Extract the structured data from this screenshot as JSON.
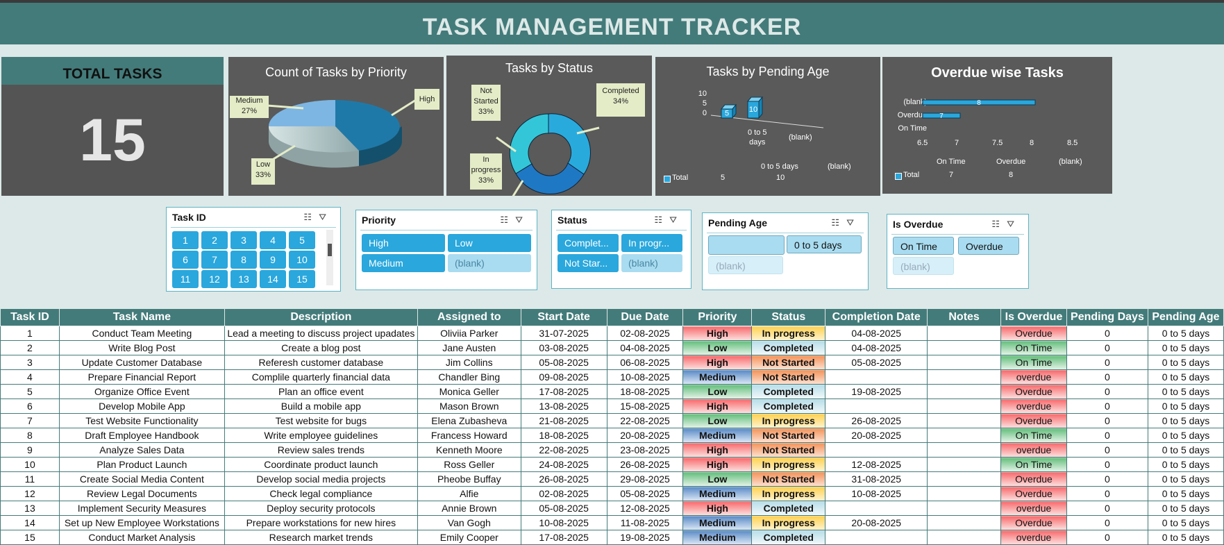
{
  "title": "TASK MANAGEMENT TRACKER",
  "total": {
    "label": "TOTAL TASKS",
    "value": "15"
  },
  "colors": {
    "teal": "#437b7a",
    "panel": "#545454",
    "slicer_selected": "#2aa7dc",
    "high": "#f8696b",
    "low": "#63be7b",
    "medium": "#5a8ac6"
  },
  "chart_data": [
    {
      "type": "pie",
      "title": "Count of Tasks by Priority",
      "categories": [
        "High",
        "Low",
        "Medium"
      ],
      "values": [
        40,
        33,
        27
      ],
      "labels": {
        "High": "High",
        "Low": "Low",
        "Low_pct": "33%",
        "Medium": "Medium",
        "Medium_pct": "27%"
      }
    },
    {
      "type": "pie",
      "title": "Tasks by Status",
      "categories": [
        "Completed",
        "In progress",
        "Not Started"
      ],
      "values": [
        34,
        33,
        33
      ],
      "labels": {
        "Completed": "Completed",
        "Completed_pct": "34%",
        "In_progress_1": "In",
        "In_progress_2": "progress",
        "In_progress_pct": "33%",
        "Not_started_1": "Not",
        "Not_started_2": "Started",
        "Not_started_pct": "33%"
      }
    },
    {
      "type": "bar",
      "title": "Tasks by Pending Age",
      "categories": [
        "0 to 5 days",
        "(blank)"
      ],
      "series": [
        {
          "name": "Total",
          "values": [
            5,
            10
          ]
        }
      ],
      "ticks": [
        "10",
        "5",
        "0"
      ],
      "cat_label_1a": "0 to 5",
      "cat_label_1b": "days",
      "table_row": [
        "Total",
        "5",
        "10"
      ]
    },
    {
      "type": "bar",
      "title": "Overdue wise Tasks",
      "categories": [
        "On Time",
        "Overdue",
        "(blank)"
      ],
      "series": [
        {
          "name": "Total",
          "values": [
            7,
            8,
            null
          ]
        }
      ],
      "xlim": [
        6.5,
        8.5
      ],
      "xticks": [
        "6.5",
        "7",
        "7.5",
        "8",
        "8.5"
      ],
      "table_row": [
        "Total",
        "7",
        "8"
      ]
    }
  ],
  "slicers": {
    "taskid": {
      "title": "Task ID",
      "items": [
        "1",
        "2",
        "3",
        "4",
        "5",
        "6",
        "7",
        "8",
        "9",
        "10",
        "11",
        "12",
        "13",
        "14",
        "15"
      ]
    },
    "priority": {
      "title": "Priority",
      "items": [
        "High",
        "Low",
        "Medium",
        "(blank)"
      ]
    },
    "status": {
      "title": "Status",
      "items": [
        "Complet...",
        "In progr...",
        "Not Star...",
        "(blank)"
      ]
    },
    "pending": {
      "title": "Pending Age",
      "items": [
        "",
        "0 to 5 days",
        "(blank)"
      ]
    },
    "overdue": {
      "title": "Is Overdue",
      "items": [
        "On Time",
        "Overdue",
        "(blank)"
      ]
    }
  },
  "table": {
    "headers": [
      "Task ID",
      "Task Name",
      "Description",
      "Assigned to",
      "Start Date",
      "Due Date",
      "Priority",
      "Status",
      "Completion Date",
      "Notes",
      "Is Overdue",
      "Pending Days",
      "Pending Age"
    ],
    "rows": [
      [
        "1",
        "Conduct Team Meeting",
        "Lead a meeting to discuss project upadates",
        "Oliviia Parker",
        "31-07-2025",
        "02-08-2025",
        "High",
        "In progress",
        "04-08-2025",
        "",
        "Overdue",
        "0",
        "0 to 5 days"
      ],
      [
        "2",
        "Write Blog Post",
        "Create a blog post",
        "Jane Austen",
        "03-08-2025",
        "04-08-2025",
        "Low",
        "Completed",
        "04-08-2025",
        "",
        "On Time",
        "0",
        "0 to 5 days"
      ],
      [
        "3",
        "Update Customer Database",
        "Referesh customer database",
        "Jim Collins",
        "05-08-2025",
        "06-08-2025",
        "High",
        "Not Started",
        "05-08-2025",
        "",
        "On Time",
        "0",
        "0 to 5 days"
      ],
      [
        "4",
        "Prepare Financial Report",
        "Complile quarterly financial data",
        "Chandler Bing",
        "09-08-2025",
        "10-08-2025",
        "Medium",
        "Not Started",
        "",
        "",
        "overdue",
        "0",
        "0 to 5 days"
      ],
      [
        "5",
        "Organize Office Event",
        "Plan an office event",
        "Monica Geller",
        "17-08-2025",
        "18-08-2025",
        "Low",
        "Completed",
        "19-08-2025",
        "",
        "Overdue",
        "0",
        "0 to 5 days"
      ],
      [
        "6",
        "Develop Mobile App",
        "Build a mobile app",
        "Mason Brown",
        "13-08-2025",
        "15-08-2025",
        "High",
        "Completed",
        "",
        "",
        "overdue",
        "0",
        "0 to 5 days"
      ],
      [
        "7",
        "Test Website Functionality",
        "Test website for bugs",
        "Elena Zubasheva",
        "21-08-2025",
        "22-08-2025",
        "Low",
        "In progress",
        "26-08-2025",
        "",
        "Overdue",
        "0",
        "0 to 5 days"
      ],
      [
        "8",
        "Draft Employee Handbook",
        "Write employee guidelines",
        "Francess Howard",
        "18-08-2025",
        "20-08-2025",
        "Medium",
        "Not Started",
        "20-08-2025",
        "",
        "On Time",
        "0",
        "0 to 5 days"
      ],
      [
        "9",
        "Analyze Sales Data",
        "Review sales trends",
        "Kenneth Moore",
        "22-08-2025",
        "23-08-2025",
        "High",
        "Not Started",
        "",
        "",
        "overdue",
        "0",
        "0 to 5 days"
      ],
      [
        "10",
        "Plan Product Launch",
        "Coordinate product launch",
        "Ross Geller",
        "24-08-2025",
        "26-08-2025",
        "High",
        "In progress",
        "12-08-2025",
        "",
        "On Time",
        "0",
        "0 to 5 days"
      ],
      [
        "11",
        "Create Social Media Content",
        "Develop social media projects",
        "Pheobe Buffay",
        "26-08-2025",
        "29-08-2025",
        "Low",
        "Not Started",
        "31-08-2025",
        "",
        "Overdue",
        "0",
        "0 to 5 days"
      ],
      [
        "12",
        "Review Legal Documents",
        "Check legal compliance",
        "Alfie",
        "02-08-2025",
        "05-08-2025",
        "Medium",
        "In progress",
        "10-08-2025",
        "",
        "Overdue",
        "0",
        "0 to 5 days"
      ],
      [
        "13",
        "Implement Security Measures",
        "Deploy security protocols",
        "Annie Brown",
        "05-08-2025",
        "12-08-2025",
        "High",
        "Completed",
        "",
        "",
        "overdue",
        "0",
        "0 to 5 days"
      ],
      [
        "14",
        "Set up New Employee Workstations",
        "Prepare workstations for new hires",
        "Van Gogh",
        "10-08-2025",
        "11-08-2025",
        "Medium",
        "In progress",
        "20-08-2025",
        "",
        "Overdue",
        "0",
        "0 to 5 days"
      ],
      [
        "15",
        "Conduct Market Analysis",
        "Research market trends",
        "Emily Cooper",
        "17-08-2025",
        "19-08-2025",
        "Medium",
        "Completed",
        "",
        "",
        "overdue",
        "0",
        "0 to 5 days"
      ]
    ]
  }
}
